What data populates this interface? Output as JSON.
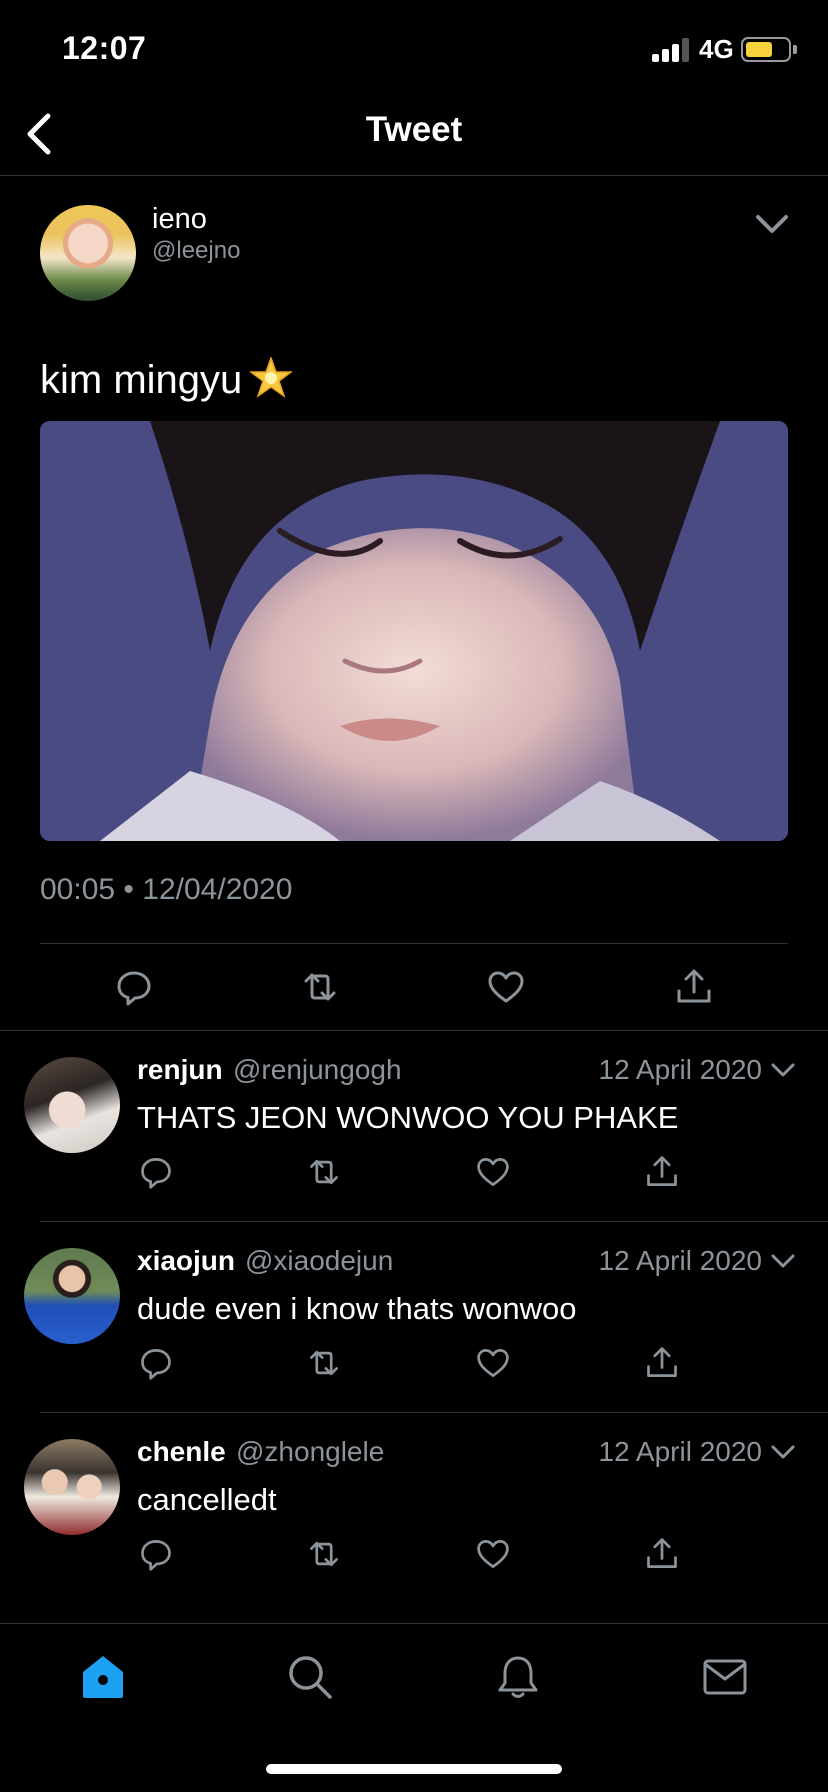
{
  "status_bar": {
    "time": "12:07",
    "network": "4G"
  },
  "nav": {
    "title": "Tweet"
  },
  "tweet": {
    "author_name": "ieno",
    "author_handle": "@leejno",
    "text": "kim mingyu",
    "emoji": "star-emoji",
    "time": "00:05",
    "separator": "•",
    "date": "12/04/2020"
  },
  "replies": [
    {
      "name": "renjun",
      "handle": "@renjungogh",
      "date": "12 April 2020",
      "text": "THATS JEON WONWOO YOU PHAKE"
    },
    {
      "name": "xiaojun",
      "handle": "@xiaodejun",
      "date": "12 April 2020",
      "text": "dude even i know thats wonwoo"
    },
    {
      "name": "chenle",
      "handle": "@zhonglele",
      "date": "12 April 2020",
      "text": "cancelledt"
    }
  ],
  "tabs": [
    {
      "name": "home",
      "icon": "home-icon",
      "active": true
    },
    {
      "name": "search",
      "icon": "search-icon",
      "active": false
    },
    {
      "name": "notifications",
      "icon": "bell-icon",
      "active": false
    },
    {
      "name": "messages",
      "icon": "mail-icon",
      "active": false
    }
  ],
  "colors": {
    "background": "#000000",
    "text": "#ffffff",
    "secondary": "#8b949a",
    "accent": "#1da1f2",
    "battery": "#f6d23c"
  }
}
